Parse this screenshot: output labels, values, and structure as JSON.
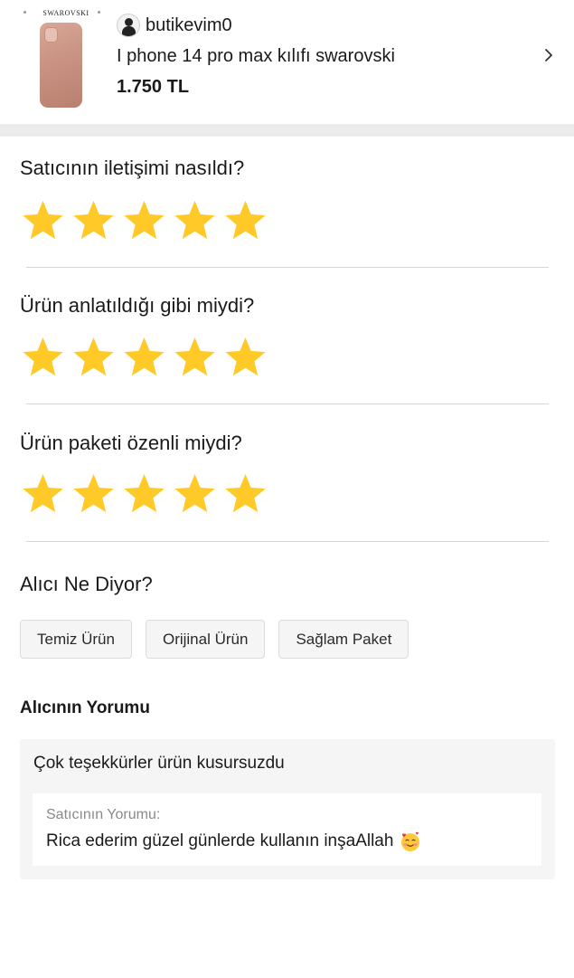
{
  "product": {
    "image_brand_text": "SWAROVSKI",
    "seller_name": "butikevim0",
    "title": "I phone 14 pro max kılıfı swarovski",
    "price": "1.750 TL"
  },
  "ratings": [
    {
      "question": "Satıcının iletişimi nasıldı?",
      "stars": 5,
      "max_stars": 5
    },
    {
      "question": "Ürün anlatıldığı gibi miydi?",
      "stars": 5,
      "max_stars": 5
    },
    {
      "question": "Ürün paketi özenli miydi?",
      "stars": 5,
      "max_stars": 5
    }
  ],
  "buyer_says": {
    "title": "Alıcı Ne Diyor?",
    "tags": [
      "Temiz Ürün",
      "Orijinal Ürün",
      "Sağlam Paket"
    ]
  },
  "comment": {
    "title": "Alıcının Yorumu",
    "text": "Çok teşekkürler ürün kusursuzdu",
    "reply_label": "Satıcının Yorumu:",
    "reply_text": "Rica ederim güzel günlerde kullanın inşaAllah",
    "reply_emoji": "smiling-face-with-hearts"
  },
  "colors": {
    "star": "#FFCA28",
    "divider_band": "#ECECEC",
    "tag_bg": "#F5F5F5",
    "comment_bg": "#F5F5F5"
  }
}
